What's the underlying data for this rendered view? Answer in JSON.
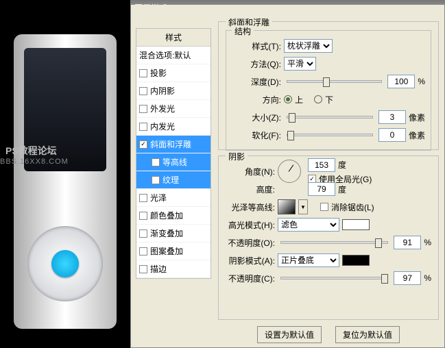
{
  "watermark": {
    "l1": "PS教程论坛",
    "l2": "BBS.16XX8.COM"
  },
  "dialog": {
    "title": "图层样式"
  },
  "sidebar": {
    "header": "样式",
    "blend_header": "混合选项:默认",
    "items": [
      {
        "label": "投影",
        "checked": false,
        "selected": false,
        "child": false
      },
      {
        "label": "内阴影",
        "checked": false,
        "selected": false,
        "child": false
      },
      {
        "label": "外发光",
        "checked": false,
        "selected": false,
        "child": false
      },
      {
        "label": "内发光",
        "checked": false,
        "selected": false,
        "child": false
      },
      {
        "label": "斜面和浮雕",
        "checked": true,
        "selected": true,
        "child": false
      },
      {
        "label": "等高线",
        "checked": false,
        "selected": true,
        "child": true
      },
      {
        "label": "纹理",
        "checked": false,
        "selected": true,
        "child": true
      },
      {
        "label": "光泽",
        "checked": false,
        "selected": false,
        "child": false
      },
      {
        "label": "颜色叠加",
        "checked": false,
        "selected": false,
        "child": false
      },
      {
        "label": "渐变叠加",
        "checked": false,
        "selected": false,
        "child": false
      },
      {
        "label": "图案叠加",
        "checked": false,
        "selected": false,
        "child": false
      },
      {
        "label": "描边",
        "checked": false,
        "selected": false,
        "child": false
      }
    ]
  },
  "bevel": {
    "title": "斜面和浮雕",
    "structure_title": "结构",
    "style_label": "样式(T):",
    "style_value": "枕状浮雕",
    "technique_label": "方法(Q):",
    "technique_value": "平滑",
    "depth_label": "深度(D):",
    "depth_value": "100",
    "depth_unit": "%",
    "direction_label": "方向:",
    "up": "上",
    "down": "下",
    "size_label": "大小(Z):",
    "size_value": "3",
    "size_unit": "像素",
    "soften_label": "软化(F):",
    "soften_value": "0",
    "soften_unit": "像素"
  },
  "shading": {
    "title": "阴影",
    "angle_label": "角度(N):",
    "angle_value": "153",
    "angle_unit": "度",
    "global_label": "使用全局光(G)",
    "altitude_label": "高度:",
    "altitude_value": "79",
    "altitude_unit": "度",
    "gloss_label": "光泽等高线:",
    "antialias_label": "消除锯齿(L)",
    "hmode_label": "高光模式(H):",
    "hmode_value": "滤色",
    "hop_label": "不透明度(O):",
    "hop_value": "91",
    "pct": "%",
    "smode_label": "阴影模式(A):",
    "smode_value": "正片叠底",
    "sop_label": "不透明度(C):",
    "sop_value": "97",
    "hcolor": "#ffffff",
    "scolor": "#000000"
  },
  "buttons": {
    "default": "设置为默认值",
    "reset": "复位为默认值"
  }
}
